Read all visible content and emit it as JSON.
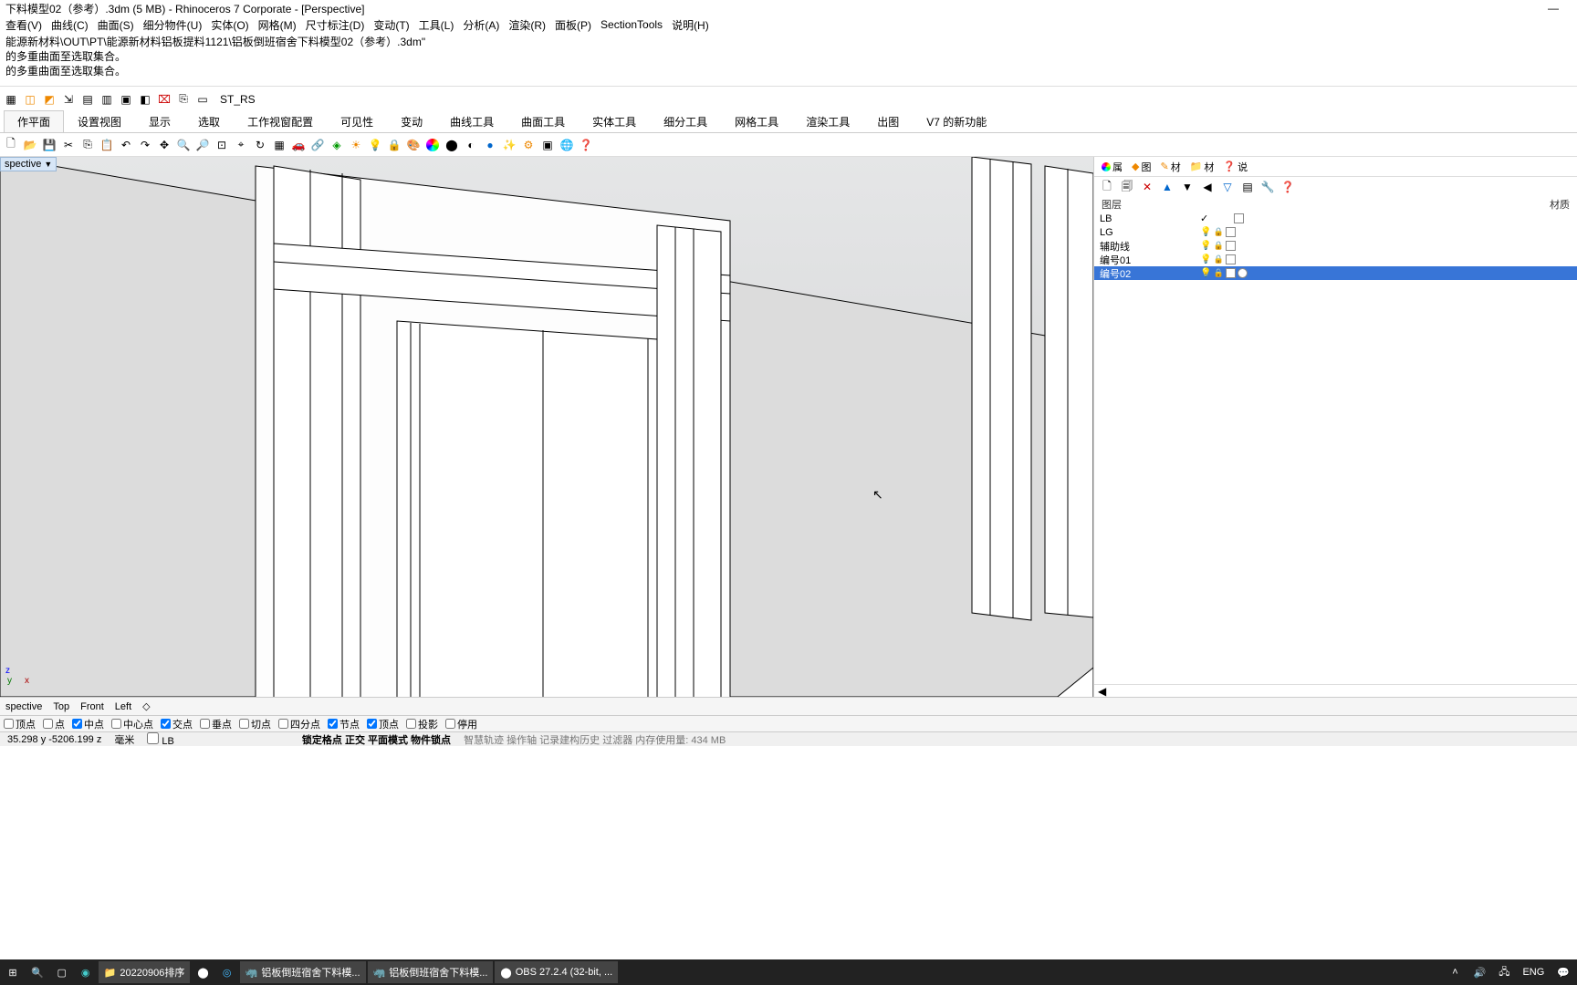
{
  "titlebar": {
    "text": "下料模型02（参考）.3dm (5 MB) - Rhinoceros 7 Corporate - [Perspective]"
  },
  "menus": [
    "查看(V)",
    "曲线(C)",
    "曲面(S)",
    "细分物件(U)",
    "实体(O)",
    "网格(M)",
    "尺寸标注(D)",
    "变动(T)",
    "工具(L)",
    "分析(A)",
    "渲染(R)",
    "面板(P)",
    "SectionTools",
    "说明(H)"
  ],
  "cmd": {
    "line1": "能源新材料\\OUT\\PT\\能源新材料铝板提料1121\\铝板倒班宿舍下料模型02（参考）.3dm\"",
    "line2": "的多重曲面至选取集合。",
    "line3": "的多重曲面至选取集合。"
  },
  "toolbar1_label": "ST_RS",
  "tabs": [
    "作平面",
    "设置视图",
    "显示",
    "选取",
    "工作视窗配置",
    "可见性",
    "变动",
    "曲线工具",
    "曲面工具",
    "实体工具",
    "细分工具",
    "网格工具",
    "渲染工具",
    "出图",
    "V7 的新功能"
  ],
  "viewport_label": "spective",
  "right_tabs": [
    "属",
    "图",
    "材",
    "材",
    "说"
  ],
  "rp_header": {
    "left": "图层",
    "right": "材质"
  },
  "layers": [
    {
      "name": "LB",
      "current": true,
      "visible": true,
      "locked": false,
      "color": "#ffffff"
    },
    {
      "name": "LG",
      "current": false,
      "visible": true,
      "locked": true,
      "color": "#ffffff"
    },
    {
      "name": "辅助线",
      "current": false,
      "visible": true,
      "locked": true,
      "color": "#ffffff"
    },
    {
      "name": "编号01",
      "current": false,
      "visible": true,
      "locked": true,
      "color": "#ffffff"
    },
    {
      "name": "编号02",
      "current": false,
      "visible": true,
      "locked": true,
      "color": "#ffffff",
      "selected": true
    }
  ],
  "view_tabs": [
    "spective",
    "Top",
    "Front",
    "Left",
    "◇"
  ],
  "osnaps": [
    {
      "label": "顶点",
      "on": false
    },
    {
      "label": "点",
      "on": false
    },
    {
      "label": "中点",
      "on": true
    },
    {
      "label": "中心点",
      "on": false
    },
    {
      "label": "交点",
      "on": true
    },
    {
      "label": "垂点",
      "on": false
    },
    {
      "label": "切点",
      "on": false
    },
    {
      "label": "四分点",
      "on": false
    },
    {
      "label": "节点",
      "on": true
    },
    {
      "label": "顶点",
      "on": true
    },
    {
      "label": "投影",
      "on": false
    },
    {
      "label": "停用",
      "on": false
    }
  ],
  "status": {
    "coord": "35.298    y -5206.199       z",
    "units": "毫米",
    "lb_cb": "LB",
    "modes": "锁定格点  正交  平面模式  物件锁点",
    "rest": "智慧轨迹  操作轴  记录建构历史  过滤器  内存使用量: 434 MB"
  },
  "taskbar": {
    "folder": "20220906排序",
    "app1": "铝板倒班宿舍下料模...",
    "app2": "铝板倒班宿舍下料模...",
    "obs": "OBS 27.2.4 (32-bit, ...",
    "lang": "ENG"
  }
}
